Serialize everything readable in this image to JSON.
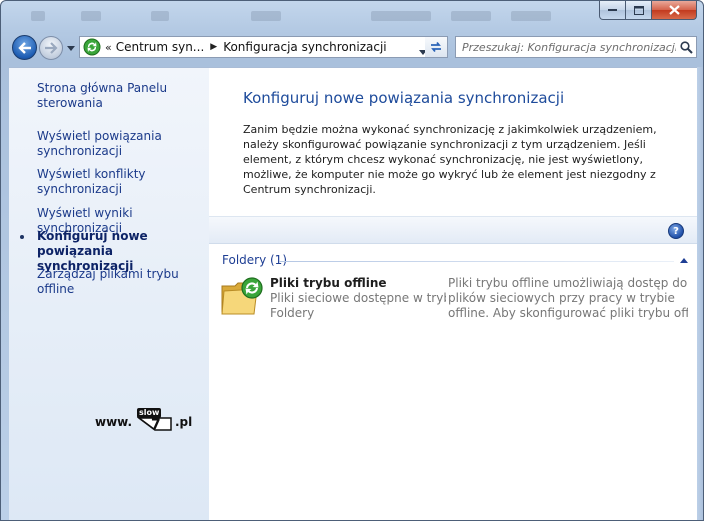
{
  "window": {
    "colors": {
      "title_accent": "#1e4b9b",
      "link": "#1b3a8a",
      "close": "#c23a1e"
    }
  },
  "address_bar": {
    "overflow": "«",
    "crumbs": [
      "Centrum syn...",
      "Konfiguracja synchronizacji"
    ]
  },
  "search": {
    "placeholder": "Przeszukaj: Konfiguracja synchronizacji"
  },
  "sidebar": {
    "items": [
      {
        "label": "Strona główna Panelu sterowania",
        "active": false
      },
      {
        "label": "Wyświetl powiązania synchronizacji",
        "active": false
      },
      {
        "label": "Wyświetl konflikty synchronizacji",
        "active": false
      },
      {
        "label": "Wyświetl wyniki synchronizacji",
        "active": false
      },
      {
        "label": "Konfiguruj nowe powiązania synchronizacji",
        "active": true
      },
      {
        "label": "Zarządzaj plikami trybu offline",
        "active": false
      }
    ]
  },
  "watermark": {
    "prefix": "www.",
    "logo_top": "slow",
    "logo_mark": "7",
    "suffix": ".pl"
  },
  "main": {
    "title": "Konfiguruj nowe powiązania synchronizacji",
    "description": "Zanim będzie można wykonać synchronizację z jakimkolwiek urządzeniem, należy skonfigurować powiązanie synchronizacji z tym urządzeniem. Jeśli element, z którym chcesz wykonać synchronizację, nie jest wyświetlony, możliwe, że komputer nie może go wykryć lub że element jest niezgodny z Centrum synchronizacji.",
    "help_glyph": "?",
    "group": {
      "label": "Foldery (1)"
    },
    "items": [
      {
        "name": "Pliki trybu offline",
        "subtitle": "Pliki sieciowe dostępne w tryb...",
        "type": "Foldery",
        "description_lines": [
          "Pliki trybu offline umożliwiają dostęp do",
          "plików sieciowych przy pracy w trybie",
          "offline. Aby skonfigurować pliki trybu offli..."
        ]
      }
    ]
  }
}
